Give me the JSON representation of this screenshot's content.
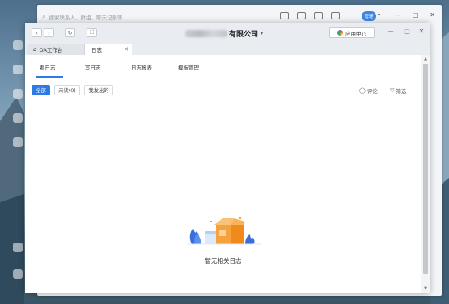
{
  "back_window": {
    "search_placeholder": "搜索联系人、群组、聊天记录等",
    "avatar_text": "管理",
    "window_controls": [
      "—",
      "□",
      "✕"
    ]
  },
  "titlebar": {
    "company_suffix": "有限公司",
    "app_center_label": "应用中心",
    "window_controls": [
      "ㅡ",
      "□",
      "✕"
    ]
  },
  "tabs": [
    {
      "label": "OA工作台"
    },
    {
      "label": "日志"
    }
  ],
  "subnav": [
    "看日志",
    "写日志",
    "日志报表",
    "模板管理"
  ],
  "filters": [
    "全部",
    "未读(0)",
    "我发出的"
  ],
  "actions": {
    "comment": "评论",
    "filter": "筛选"
  },
  "empty_state": {
    "message": "暂无相关日志"
  },
  "colors": {
    "accent": "#2c7be5",
    "illustration_orange": "#f5a23c",
    "illustration_blue": "#3a6fd8"
  }
}
